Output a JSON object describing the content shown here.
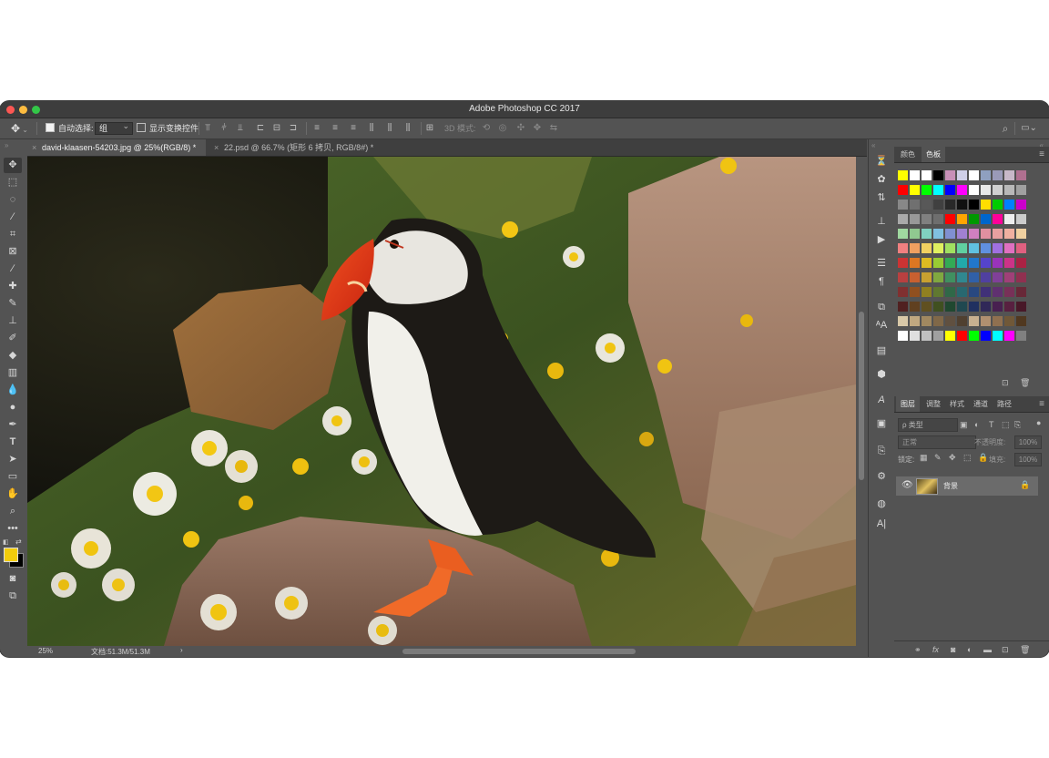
{
  "app": {
    "title": "Adobe Photoshop CC 2017"
  },
  "options_bar": {
    "auto_select_label": "自动选择:",
    "auto_select_value": "组",
    "show_transform_label": "显示变换控件",
    "mode_3d_label": "3D 模式:"
  },
  "tabs": [
    {
      "label": "david-klaasen-54203.jpg @ 25%(RGB/8) *",
      "active": true
    },
    {
      "label": "22.psd @ 66.7% (矩形 6 拷贝, RGB/8#) *",
      "active": false
    }
  ],
  "status": {
    "zoom": "25%",
    "doc_size": "文档:51.3M/51.3M"
  },
  "swatch_panel": {
    "tab_color": "颜色",
    "tab_swatches": "色板"
  },
  "layers_panel": {
    "tabs": [
      "图层",
      "调整",
      "样式",
      "通道",
      "路径"
    ],
    "filter_label": "ρ 类型",
    "blend_mode": "正常",
    "opacity_label": "不透明度:",
    "opacity_value": "100%",
    "lock_label": "锁定:",
    "fill_label": "填充:",
    "fill_value": "100%",
    "layers": [
      {
        "name": "背景",
        "visible": true,
        "locked": true
      }
    ]
  },
  "colors": {
    "foreground": "#f2cc0c",
    "background": "#000000",
    "swatches": [
      [
        "#ffff00",
        "#ffffff",
        "#ffffff",
        "#000000",
        "#c890b8",
        "#d0d0e8",
        "#ffffff",
        "#8fa0c0",
        "#9a9ab8",
        "#c8b8c8",
        "#b07090"
      ],
      [
        "#ff0000",
        "#ffff00",
        "#00ff00",
        "#00ffff",
        "#0000ff",
        "#ff00ff",
        "#ffffff",
        "#e8e8e8",
        "#d0d0d0",
        "#b8b8b8",
        "#a0a0a0"
      ],
      [
        "#888888",
        "#707070",
        "#585858",
        "#404040",
        "#282828",
        "#101010",
        "#000000",
        "#ffdd00",
        "#00cc00",
        "#0080ff",
        "#cc00cc"
      ],
      [
        "#aaaaaa",
        "#999999",
        "#808080",
        "#6e6e6e",
        "#ff0000",
        "#ffa500",
        "#009900",
        "#0066cc",
        "#ff0099",
        "#eeeeee",
        "#cccccc"
      ],
      [
        "#a0d8a0",
        "#90c890",
        "#80d0c0",
        "#80c0e0",
        "#8090d0",
        "#a080d0",
        "#d080c0",
        "#e090a0",
        "#e8a0a0",
        "#f0b0a0",
        "#f0d0a0"
      ],
      [
        "#f08080",
        "#f0a060",
        "#f0d060",
        "#e0f060",
        "#a0e060",
        "#60d0a0",
        "#60c0e0",
        "#6090e0",
        "#a070e0",
        "#e070c0",
        "#e06080"
      ],
      [
        "#cc3333",
        "#dd7722",
        "#ddbb22",
        "#99cc33",
        "#33aa55",
        "#22aaaa",
        "#2277cc",
        "#5544cc",
        "#9933bb",
        "#cc3388",
        "#aa2244"
      ],
      [
        "#b84040",
        "#c86030",
        "#c8a030",
        "#80a840",
        "#409060",
        "#308890",
        "#3060a8",
        "#5040a0",
        "#804098",
        "#a04078",
        "#903050"
      ],
      [
        "#803030",
        "#905020",
        "#908020",
        "#607830",
        "#306848",
        "#286870",
        "#284880",
        "#403078",
        "#603070",
        "#783058",
        "#682838"
      ],
      [
        "#502020",
        "#604020",
        "#605020",
        "#405020",
        "#204830",
        "#204850",
        "#203060",
        "#302858",
        "#482050",
        "#582040",
        "#481828"
      ],
      [
        "#d8c8a8",
        "#c0a880",
        "#a08860",
        "#806848",
        "#605040",
        "#504030",
        "#c8b090",
        "#b09070",
        "#907050",
        "#705838",
        "#503820"
      ],
      [
        "#ffffff",
        "#e0e0e0",
        "#c0c0c0",
        "#a0a0a0",
        "#ffff00",
        "#ff0000",
        "#00ff00",
        "#0000ff",
        "#00ffff",
        "#ff00ff",
        "#808080"
      ]
    ]
  }
}
